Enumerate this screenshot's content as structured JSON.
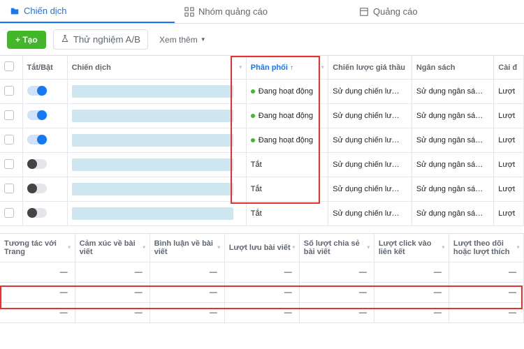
{
  "tabs": {
    "campaign": "Chiến dịch",
    "adset": "Nhóm quảng cáo",
    "ad": "Quảng cáo"
  },
  "toolbar": {
    "create": "+ Tạo",
    "ab": "Thử nghiệm A/B",
    "more": "Xem thêm"
  },
  "headers": {
    "check": "",
    "onoff": "Tắt/Bật",
    "campaign": "Chiến dịch",
    "delivery": "Phân phối",
    "bid": "Chiến lược giá thầu",
    "budget": "Ngân sách",
    "settings": "Cài đ"
  },
  "sort_arrow": "↑",
  "rows": [
    {
      "on": true,
      "status": "Đang hoạt động",
      "bid": "Sử dụng chiến lư…",
      "budget": "Sử dụng ngân sá…",
      "set": "Lượt"
    },
    {
      "on": true,
      "status": "Đang hoạt động",
      "bid": "Sử dụng chiến lư…",
      "budget": "Sử dụng ngân sá…",
      "set": "Lượt"
    },
    {
      "on": true,
      "status": "Đang hoạt động",
      "bid": "Sử dụng chiến lư…",
      "budget": "Sử dụng ngân sá…",
      "set": "Lượt"
    },
    {
      "on": false,
      "status": "Tắt",
      "bid": "Sử dụng chiến lư…",
      "budget": "Sử dụng ngân sá…",
      "set": "Lượt"
    },
    {
      "on": false,
      "status": "Tắt",
      "bid": "Sử dụng chiến lư…",
      "budget": "Sử dụng ngân sá…",
      "set": "Lượt"
    },
    {
      "on": false,
      "status": "Tắt",
      "bid": "Sử dụng chiến lư…",
      "budget": "Sử dụng ngân sá…",
      "set": "Lượt"
    }
  ],
  "lower_headers": {
    "c1": "Tương tác với Trang",
    "c2": "Cảm xúc về bài viết",
    "c3": "Bình luận về bài viết",
    "c4": "Lượt lưu bài viết",
    "c5": "Số lượt chia sẻ bài viết",
    "c6": "Lượt click vào liên kết",
    "c7": "Lượt theo dõi hoặc lượt thích"
  },
  "dash": "—"
}
